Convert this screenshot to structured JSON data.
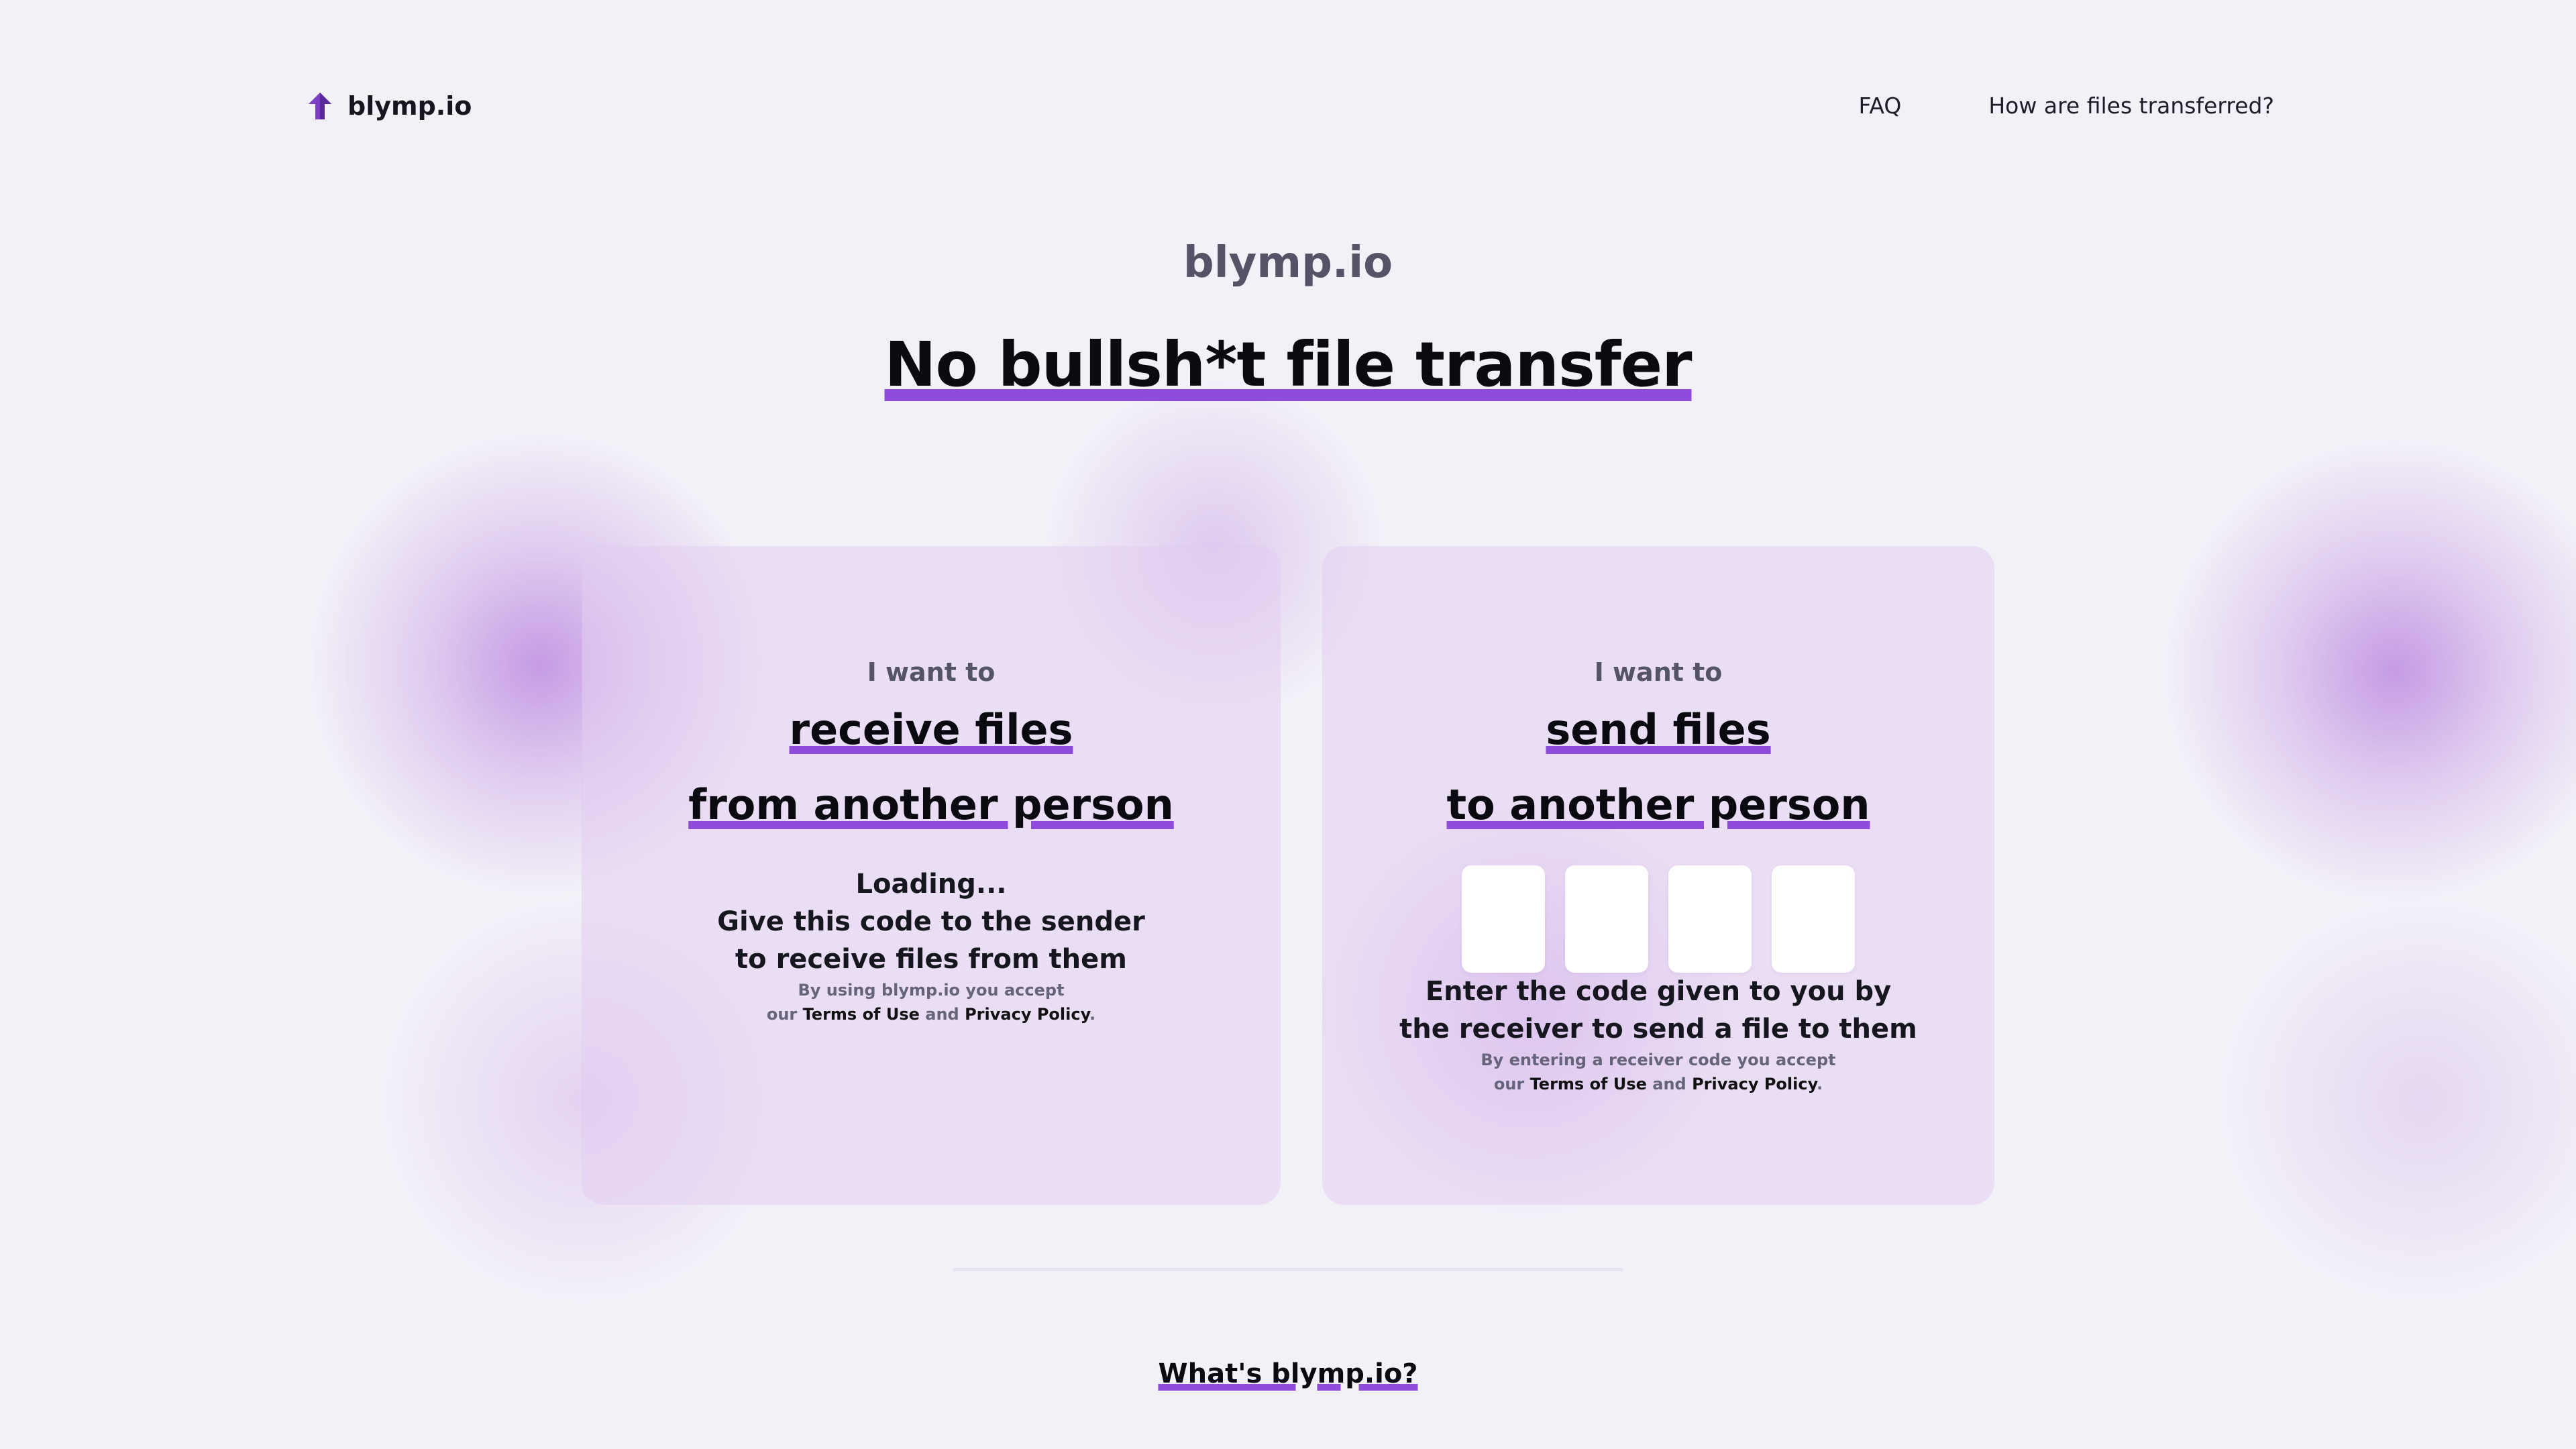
{
  "nav": {
    "logo_text": "blymp.io",
    "links": [
      "FAQ",
      "How are files transferred?"
    ]
  },
  "hero": {
    "brand": "blymp.io",
    "title": "No bullsh*t file transfer"
  },
  "receive_card": {
    "kicker": "I want to",
    "title_line1": "receive files",
    "title_line2": "from another person",
    "status": "Loading...",
    "help_line1": "Give this code to the sender",
    "help_line2": "to receive files from them",
    "legal_line1": "By using blymp.io you accept",
    "legal_our": "our",
    "terms_link": "Terms of Use",
    "legal_and": "and",
    "privacy_link": "Privacy Policy",
    "legal_end": "."
  },
  "send_card": {
    "kicker": "I want to",
    "title_line1": "send files",
    "title_line2": "to another person",
    "code_digits": [
      "",
      "",
      "",
      ""
    ],
    "help_line1": "Enter the code given to you by",
    "help_line2": "the receiver to send a file to them",
    "legal_line1": "By entering a receiver code you accept",
    "legal_our": "our",
    "terms_link": "Terms of Use",
    "legal_and": "and",
    "privacy_link": "Privacy Policy",
    "legal_end": "."
  },
  "about": {
    "title": "What's blymp.io?"
  },
  "colors": {
    "accent": "#8f4bd9",
    "background": "#f3f1f8",
    "card": "#e8dcf3",
    "muted_text": "#555366"
  },
  "icons": {
    "logo": "upload-arrow-icon"
  }
}
